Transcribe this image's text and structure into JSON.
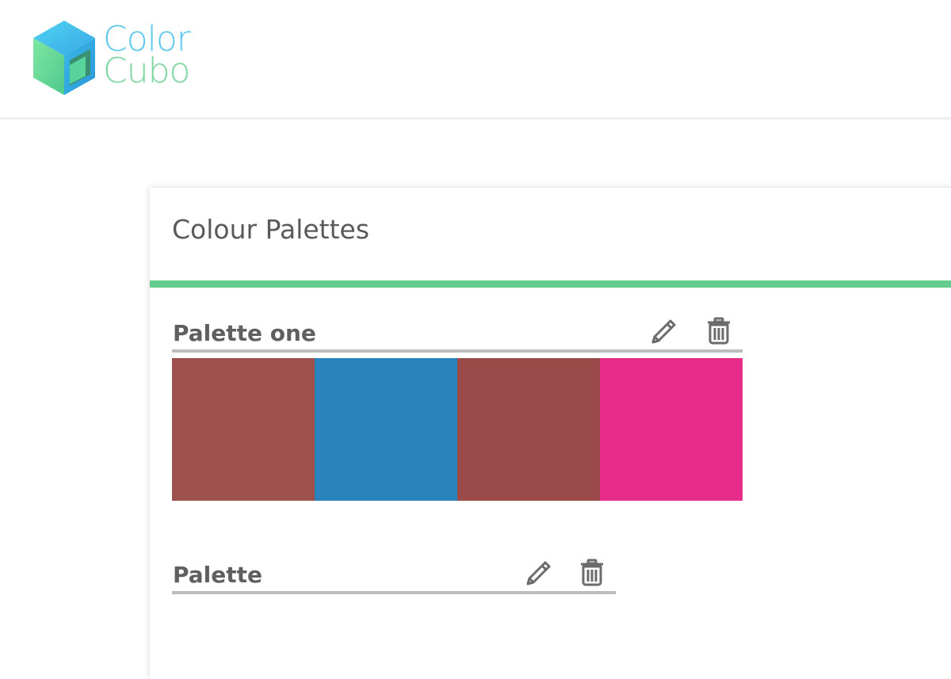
{
  "app": {
    "logo_line1": "Color",
    "logo_line2": "Cubo"
  },
  "page": {
    "title": "Colour Palettes"
  },
  "palettes": [
    {
      "name": "Palette one",
      "colors": [
        "#9e504d",
        "#2b83bd",
        "#9a4a48",
        "#e62b89"
      ],
      "edit_icon": "pencil-icon",
      "delete_icon": "trash-icon"
    },
    {
      "name": "Palette",
      "colors": [],
      "edit_icon": "pencil-icon",
      "delete_icon": "trash-icon"
    }
  ],
  "colors": {
    "accent": "#64cc8e",
    "logo_blue": "#5ec8ec",
    "logo_green": "#7fd6a0",
    "divider": "#bdbdbd"
  }
}
